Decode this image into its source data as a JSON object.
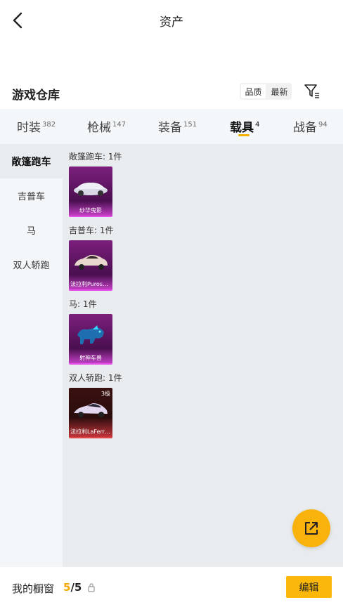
{
  "header": {
    "title": "资产"
  },
  "section": {
    "title": "游戏仓库"
  },
  "sort": {
    "options": [
      "品质",
      "最新"
    ]
  },
  "tabs": [
    {
      "label": "时装",
      "count": "382"
    },
    {
      "label": "枪械",
      "count": "147"
    },
    {
      "label": "装备",
      "count": "151"
    },
    {
      "label": "载具",
      "count": "4"
    },
    {
      "label": "战备",
      "count": "94"
    }
  ],
  "sidebar": {
    "items": [
      "敞篷跑车",
      "吉普车",
      "马",
      "双人轿跑"
    ]
  },
  "groups": [
    {
      "label": "敞篷跑车: 1件",
      "item_name": "纱华曳影",
      "grade": ""
    },
    {
      "label": "吉普车: 1件",
      "item_name": "法拉利Purosangue",
      "grade": ""
    },
    {
      "label": "马: 1件",
      "item_name": "射神车兽",
      "grade": ""
    },
    {
      "label": "双人轿跑: 1件",
      "item_name": "法拉利LaFerrari",
      "grade": "3级"
    }
  ],
  "bottom": {
    "showcase_label": "我的橱窗",
    "current": "5",
    "separator": "/",
    "total": "5",
    "edit_label": "编辑"
  },
  "colors": {
    "accent": "#f5b000",
    "purple_rarity": "#c23fc4",
    "red_rarity": "#e04848"
  }
}
